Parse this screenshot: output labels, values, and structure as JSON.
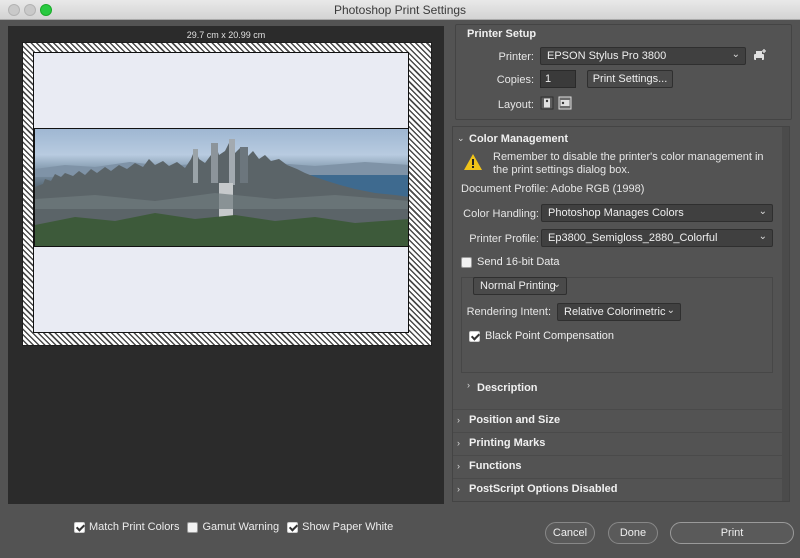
{
  "window": {
    "title": "Photoshop Print Settings"
  },
  "preview": {
    "dimensions": "29.7 cm x 20.99 cm"
  },
  "bottom_options": [
    {
      "label": "Match Print Colors",
      "checked": true
    },
    {
      "label": "Gamut Warning",
      "checked": false
    },
    {
      "label": "Show Paper White",
      "checked": true
    }
  ],
  "printer_setup": {
    "title": "Printer Setup",
    "printer_label": "Printer:",
    "printer_value": "EPSON Stylus Pro 3800",
    "copies_label": "Copies:",
    "copies_value": "1",
    "print_settings_button": "Print Settings...",
    "layout_label": "Layout:"
  },
  "color_management": {
    "title": "Color Management",
    "warning": "Remember to disable the printer's color management in the print settings dialog box.",
    "document_profile": "Document Profile: Adobe RGB (1998)",
    "color_handling_label": "Color Handling:",
    "color_handling_value": "Photoshop Manages Colors",
    "printer_profile_label": "Printer Profile:",
    "printer_profile_value": "Ep3800_Semigloss_2880_Colorful",
    "send_16bit_label": "Send 16-bit Data",
    "send_16bit_checked": false,
    "print_mode_value": "Normal Printing",
    "rendering_intent_label": "Rendering Intent:",
    "rendering_intent_value": "Relative Colorimetric",
    "black_point_label": "Black Point Compensation",
    "black_point_checked": true,
    "description_label": "Description"
  },
  "sections": [
    {
      "label": "Position and Size"
    },
    {
      "label": "Printing Marks"
    },
    {
      "label": "Functions"
    },
    {
      "label": "PostScript Options Disabled"
    }
  ],
  "buttons": {
    "cancel": "Cancel",
    "done": "Done",
    "print": "Print"
  },
  "colors": {
    "dialog_bg": "#535353",
    "preview_bg": "#2b2b2b",
    "warning_yellow": "#f0c419",
    "traffic_green": "#28c940"
  }
}
